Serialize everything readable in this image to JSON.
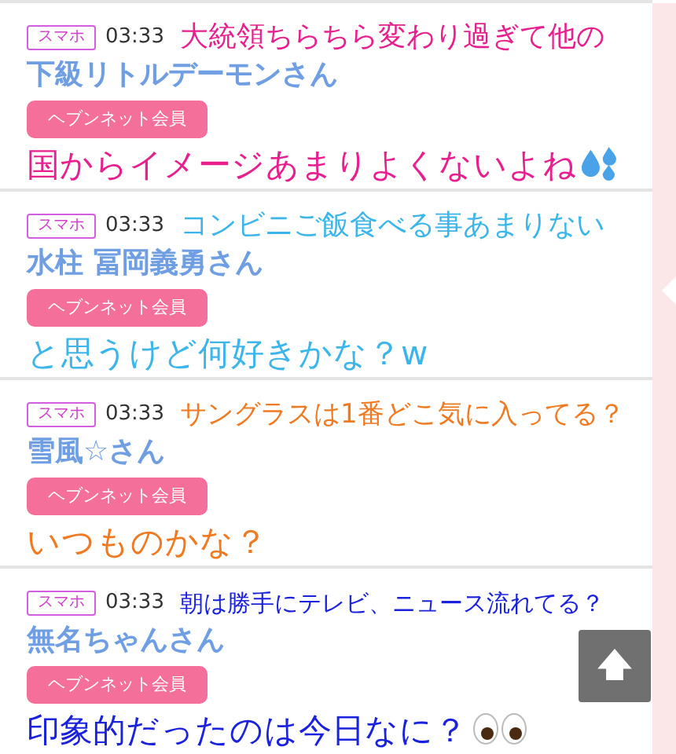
{
  "posts": [
    {
      "device": "スマホ",
      "time": "03:33",
      "name": "下級リトルデーモンさん",
      "member_button": "ヘブンネット会員",
      "caption": {
        "color": "#e8208f",
        "kind": "sweat",
        "lines": [
          "大統領ちらちら変わり過ぎて他の",
          "国からイメージあまりよくないよね"
        ]
      }
    },
    {
      "device": "スマホ",
      "time": "03:33",
      "name": "水柱 冨岡義勇さん",
      "member_button": "ヘブンネット会員",
      "caption": {
        "color": "#3cb6ea",
        "kind": "plain",
        "lines": [
          "コンビニご飯食べる事あまりない",
          "と思うけど何好きかな？w"
        ]
      }
    },
    {
      "device": "スマホ",
      "time": "03:33",
      "name": "雪風☆さん",
      "member_button": "ヘブンネット会員",
      "caption": {
        "color": "#f07a22",
        "kind": "plain",
        "lines": [
          "サングラスは1番どこ気に入ってる？",
          "いつものかな？"
        ]
      }
    },
    {
      "device": "スマホ",
      "time": "03:33",
      "name": "無名ちゃんさん",
      "member_button": "ヘブンネット会員",
      "caption": {
        "color": "#1a22dd",
        "kind": "eyes",
        "lines": [
          "朝は勝手にテレビ、ニュース流れてる？",
          "印象的だったのは今日なに？"
        ]
      }
    }
  ]
}
